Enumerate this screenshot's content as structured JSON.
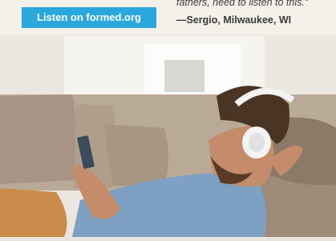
{
  "cta": {
    "label": "Listen on formed.org"
  },
  "testimonial": {
    "quote_fragment": "fathers, need to listen to this.\"",
    "author": "—Sergio, Milwaukee, WI"
  },
  "colors": {
    "cta_bg": "#2aa7dd",
    "cta_text": "#ffffff",
    "quote_text": "#3a3a3a"
  }
}
